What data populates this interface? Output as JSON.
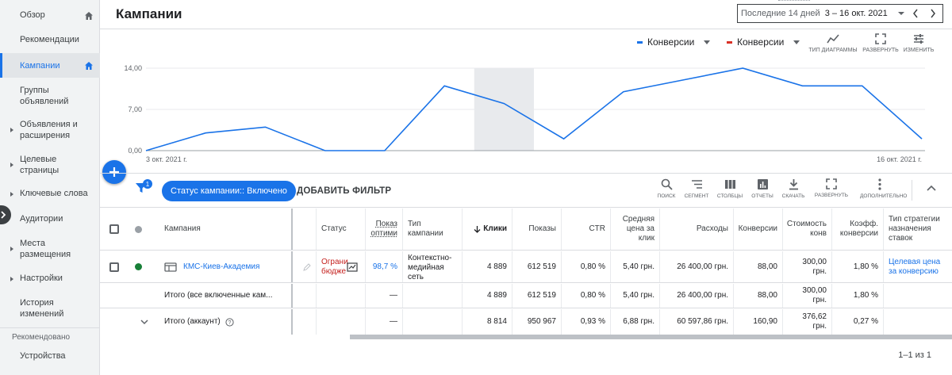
{
  "sidebar": {
    "items": [
      {
        "label": "Обзор"
      },
      {
        "label": "Рекомендации"
      },
      {
        "label": "Кампании"
      },
      {
        "label": "Группы объявлений"
      },
      {
        "label": "Объявления и расширения"
      },
      {
        "label": "Целевые страницы"
      },
      {
        "label": "Ключевые слова"
      },
      {
        "label": "Аудитории"
      },
      {
        "label": "Места размещения"
      },
      {
        "label": "Настройки"
      },
      {
        "label": "История изменений"
      }
    ],
    "section_label": "Рекомендовано",
    "section_items": [
      {
        "label": "Устройства"
      }
    ]
  },
  "header": {
    "title": "Кампании",
    "date_preset": "Последние 14 дней",
    "date_range": "3 – 16 окт. 2021"
  },
  "chart_controls": {
    "metric1": {
      "label": "Конверсии",
      "color": "#1a73e8"
    },
    "metric2": {
      "label": "Конверсии",
      "color": "#d93025"
    },
    "tools": [
      {
        "label": "ТИП ДИАГРАММЫ",
        "icon": "line-chart-icon"
      },
      {
        "label": "РАЗВЕРНУТЬ",
        "icon": "expand-icon"
      },
      {
        "label": "ИЗМЕНИТЬ",
        "icon": "tune-icon"
      }
    ]
  },
  "chart_data": {
    "type": "line",
    "x": [
      "3 окт. 2021 г.",
      "4",
      "5",
      "6",
      "7",
      "8",
      "9",
      "10",
      "11",
      "12",
      "13",
      "14",
      "15",
      "16 окт. 2021 г."
    ],
    "x_tick_labels": [
      "3 окт. 2021 г.",
      "16 окт. 2021 г."
    ],
    "y_tick_labels": [
      "0,00",
      "7,00",
      "14,00"
    ],
    "ylim": [
      0,
      14
    ],
    "series": [
      {
        "values": [
          0,
          3,
          4,
          0,
          0,
          11,
          8,
          2,
          10,
          12,
          14,
          11,
          11,
          2
        ],
        "color": "#1a73e8"
      }
    ],
    "highlight_index": 6,
    "grid": true
  },
  "filter_bar": {
    "badge": "1",
    "chip_label": "Статус кампании:: Включено",
    "add_filter_label": "ДОБАВИТЬ ФИЛЬТР",
    "tools": [
      {
        "label": "ПОИСК",
        "icon": "search-icon"
      },
      {
        "label": "СЕГМЕНТ",
        "icon": "segment-icon"
      },
      {
        "label": "СТОЛБЦЫ",
        "icon": "columns-icon"
      },
      {
        "label": "ОТЧЕТЫ",
        "icon": "reports-icon"
      },
      {
        "label": "СКАЧАТЬ",
        "icon": "download-icon"
      },
      {
        "label": "РАЗВЕРНУТЬ",
        "icon": "expand-icon"
      },
      {
        "label": "ДОПОЛНИТЕЛЬНО",
        "icon": "more-vert-icon"
      }
    ]
  },
  "table": {
    "headers": {
      "campaign": "Кампания",
      "status": "Статус",
      "opt": "Показ оптими",
      "type": "Тип кампании",
      "clicks": "Клики",
      "impr": "Показы",
      "ctr": "CTR",
      "cpc": "Средняя цена за клик",
      "cost": "Расходы",
      "conv": "Конверсии",
      "cost_conv": "Стоимость конв",
      "conv_rate": "Коэфф. конверсии",
      "bid": "Тип стратегии назначения ставок"
    },
    "rows": [
      {
        "campaign": "КМС-Киев-Академия",
        "status": "Ограни бюдже",
        "opt": "98,7 %",
        "type": "Контекстно-медийная сеть",
        "clicks": "4 889",
        "impr": "612 519",
        "ctr": "0,80 %",
        "cpc": "5,40 грн.",
        "cost": "26 400,00 грн.",
        "conv": "88,00",
        "cost_conv": "300,00 грн.",
        "conv_rate": "1,80 %",
        "bid": "Целевая цена за конверсию",
        "status_color": "#188038"
      }
    ],
    "totals": [
      {
        "label": "Итого (все включенные кам...",
        "opt": "—",
        "clicks": "4 889",
        "impr": "612 519",
        "ctr": "0,80 %",
        "cpc": "5,40 грн.",
        "cost": "26 400,00 грн.",
        "conv": "88,00",
        "cost_conv": "300,00 грн.",
        "conv_rate": "1,80 %"
      },
      {
        "label": "Итого (аккаунт)",
        "opt": "—",
        "clicks": "8 814",
        "impr": "950 967",
        "ctr": "0,93 %",
        "cpc": "6,88 грн.",
        "cost": "60 597,86 грн.",
        "conv": "160,90",
        "cost_conv": "376,62 грн.",
        "conv_rate": "0,27 %"
      }
    ],
    "pagination": "1–1 из 1"
  }
}
